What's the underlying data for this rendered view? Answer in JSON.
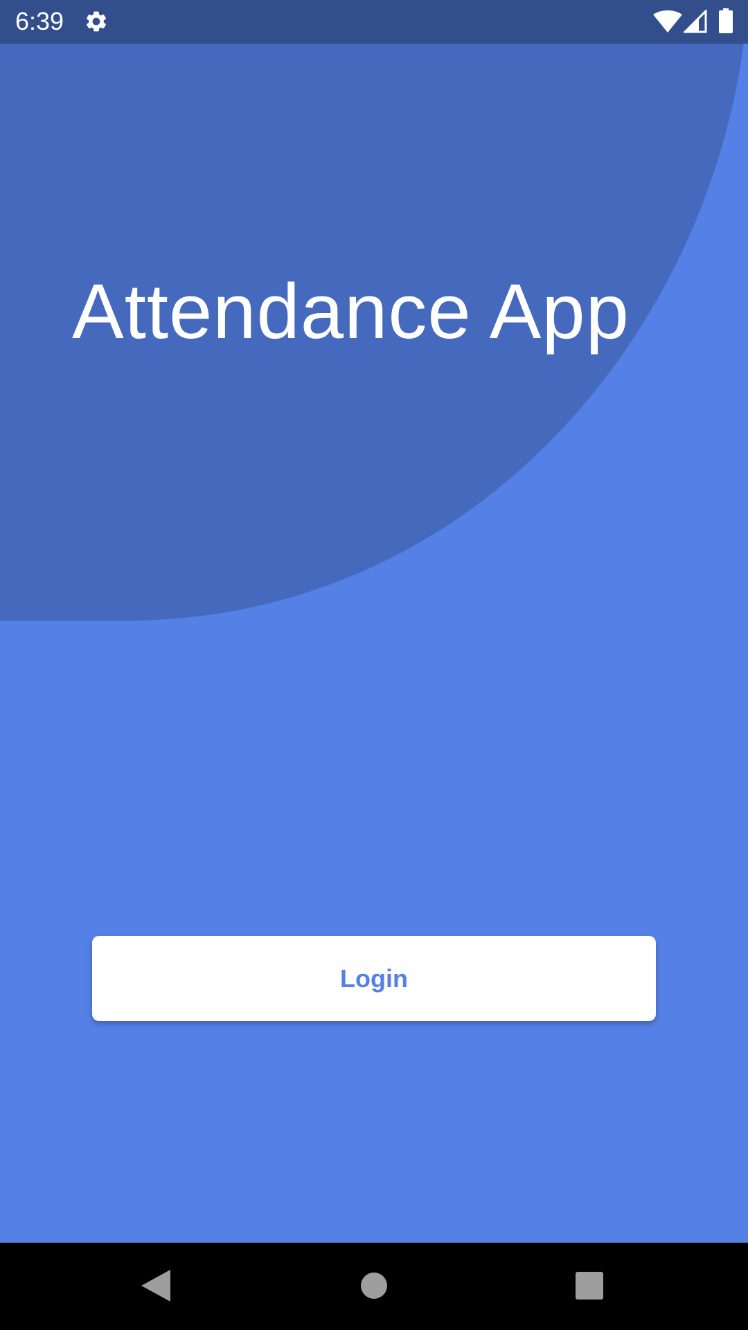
{
  "status_bar": {
    "time": "6:39",
    "icons": [
      "gear-icon",
      "wifi-icon",
      "cell-signal-icon",
      "battery-icon"
    ]
  },
  "main": {
    "title": "Attendance App",
    "login_label": "Login"
  },
  "nav_bar": {
    "icons": [
      "back-icon",
      "home-icon",
      "recents-icon"
    ]
  },
  "colors": {
    "background": "#5580e6",
    "hero_shape": "#4469bd",
    "status_bar": "#324e8b",
    "button_bg": "#ffffff",
    "button_text": "#5580e6",
    "nav_bar": "#000000",
    "nav_icons": "#9e9e9e"
  }
}
